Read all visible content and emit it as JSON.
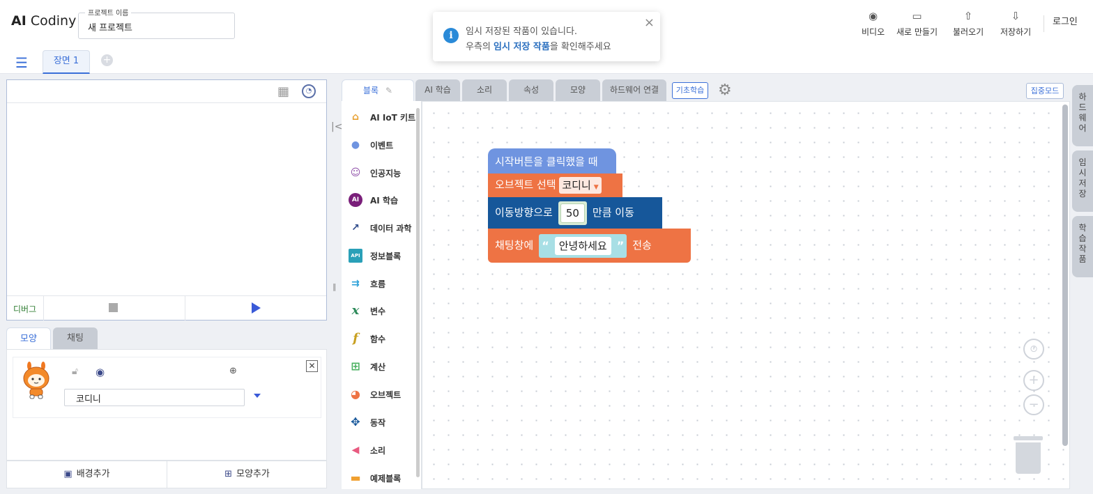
{
  "header": {
    "logo_prefix": "AI",
    "logo_name": "Codiny",
    "project_label": "프로젝트 이름",
    "project_name": "새 프로젝트",
    "buttons": [
      {
        "label": "비디오",
        "icon": "webcam-icon"
      },
      {
        "label": "새로 만들기",
        "icon": "new-window-icon"
      },
      {
        "label": "불러오기",
        "icon": "upload-icon"
      },
      {
        "label": "저장하기",
        "icon": "download-icon"
      }
    ],
    "login": "로그인"
  },
  "toast": {
    "line1": "임시 저장된 작품이 있습니다.",
    "line2_pre": "우측의 ",
    "line2_highlight": "임시 저장 작품",
    "line2_post": "을 확인해주세요",
    "close": "×"
  },
  "scenes": {
    "tabs": [
      "장면 1"
    ],
    "add": "+"
  },
  "stage": {
    "debug_label": "디버그",
    "speed_icon_text": "🕓"
  },
  "object_panel": {
    "tabs": [
      "모양",
      "채팅"
    ],
    "object_name": "코디니",
    "add_background": "배경추가",
    "add_shape": "모양추가"
  },
  "block_tabs": [
    "블록",
    "AI 학습",
    "소리",
    "속성",
    "모양",
    "하드웨어 연결"
  ],
  "basic_learning": "기초학습",
  "focus_mode": "집중모드",
  "palette": [
    {
      "label": "AI IoT 키트",
      "icon": "house-icon",
      "color": "#e8a030"
    },
    {
      "label": "이벤트",
      "icon": "location-pin-icon",
      "color": "#6f94e0"
    },
    {
      "label": "인공지능",
      "icon": "robot-icon",
      "color": "#8e4ea8"
    },
    {
      "label": "AI 학습",
      "icon": "ai-badge-icon",
      "color": "#7a1f7a"
    },
    {
      "label": "데이터 과학",
      "icon": "line-chart-icon",
      "color": "#2e4a8a"
    },
    {
      "label": "정보블록",
      "icon": "api-icon",
      "color": "#2aa0b8"
    },
    {
      "label": "흐름",
      "icon": "flow-arrows-icon",
      "color": "#2aa0d8"
    },
    {
      "label": "변수",
      "icon": "variable-x-icon",
      "color": "#2e8a5a"
    },
    {
      "label": "함수",
      "icon": "function-f-icon",
      "color": "#c8a020"
    },
    {
      "label": "계산",
      "icon": "calculator-icon",
      "color": "#4ab060"
    },
    {
      "label": "오브젝트",
      "icon": "shapes-icon",
      "color": "#ee7344"
    },
    {
      "label": "동작",
      "icon": "move-arrows-icon",
      "color": "#16579a"
    },
    {
      "label": "소리",
      "icon": "speaker-icon",
      "color": "#e85a80"
    },
    {
      "label": "예제블록",
      "icon": "folder-icon",
      "color": "#f0a030"
    }
  ],
  "script": {
    "start": "시작버튼을 클릭했을 때",
    "select_label": "오브젝트 선택",
    "select_value": "코디니",
    "move_pre": "이동방향으로",
    "move_value": "50",
    "move_post": "만큼 이동",
    "chat_pre": "채팅창에",
    "chat_value": "안녕하세요",
    "chat_post": "전송",
    "open_quote": "“",
    "close_quote": "”"
  },
  "side_tabs": [
    "하드웨어",
    "임시저장",
    "학습작품"
  ]
}
